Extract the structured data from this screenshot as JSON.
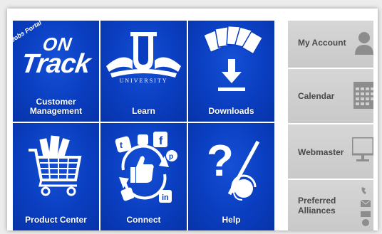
{
  "tiles": {
    "customer": {
      "brand_tag": "Jobs Portal",
      "brand_on": "ON",
      "brand_track": "Track",
      "label_line1": "Customer",
      "label_line2": "Management"
    },
    "learn": {
      "emblem_letter": "U",
      "emblem_text": "UNIVERSITY",
      "label": "Learn"
    },
    "downloads": {
      "label": "Downloads"
    },
    "product_center": {
      "label": "Product Center"
    },
    "connect": {
      "label": "Connect"
    },
    "help": {
      "label": "Help"
    }
  },
  "side": {
    "my_account": {
      "label": "My Account",
      "icon": "user-icon"
    },
    "calendar": {
      "label": "Calendar",
      "icon": "calendar-icon"
    },
    "webmaster": {
      "label": "Webmaster",
      "icon": "monitor-icon"
    },
    "preferred": {
      "label_line1": "Preferred",
      "label_line2": "Alliances",
      "icon": "contact-icons"
    }
  },
  "colors": {
    "tile_blue": "#0a3ec0",
    "side_gray": "#cfcfcf",
    "side_text": "#4a4a4a"
  }
}
